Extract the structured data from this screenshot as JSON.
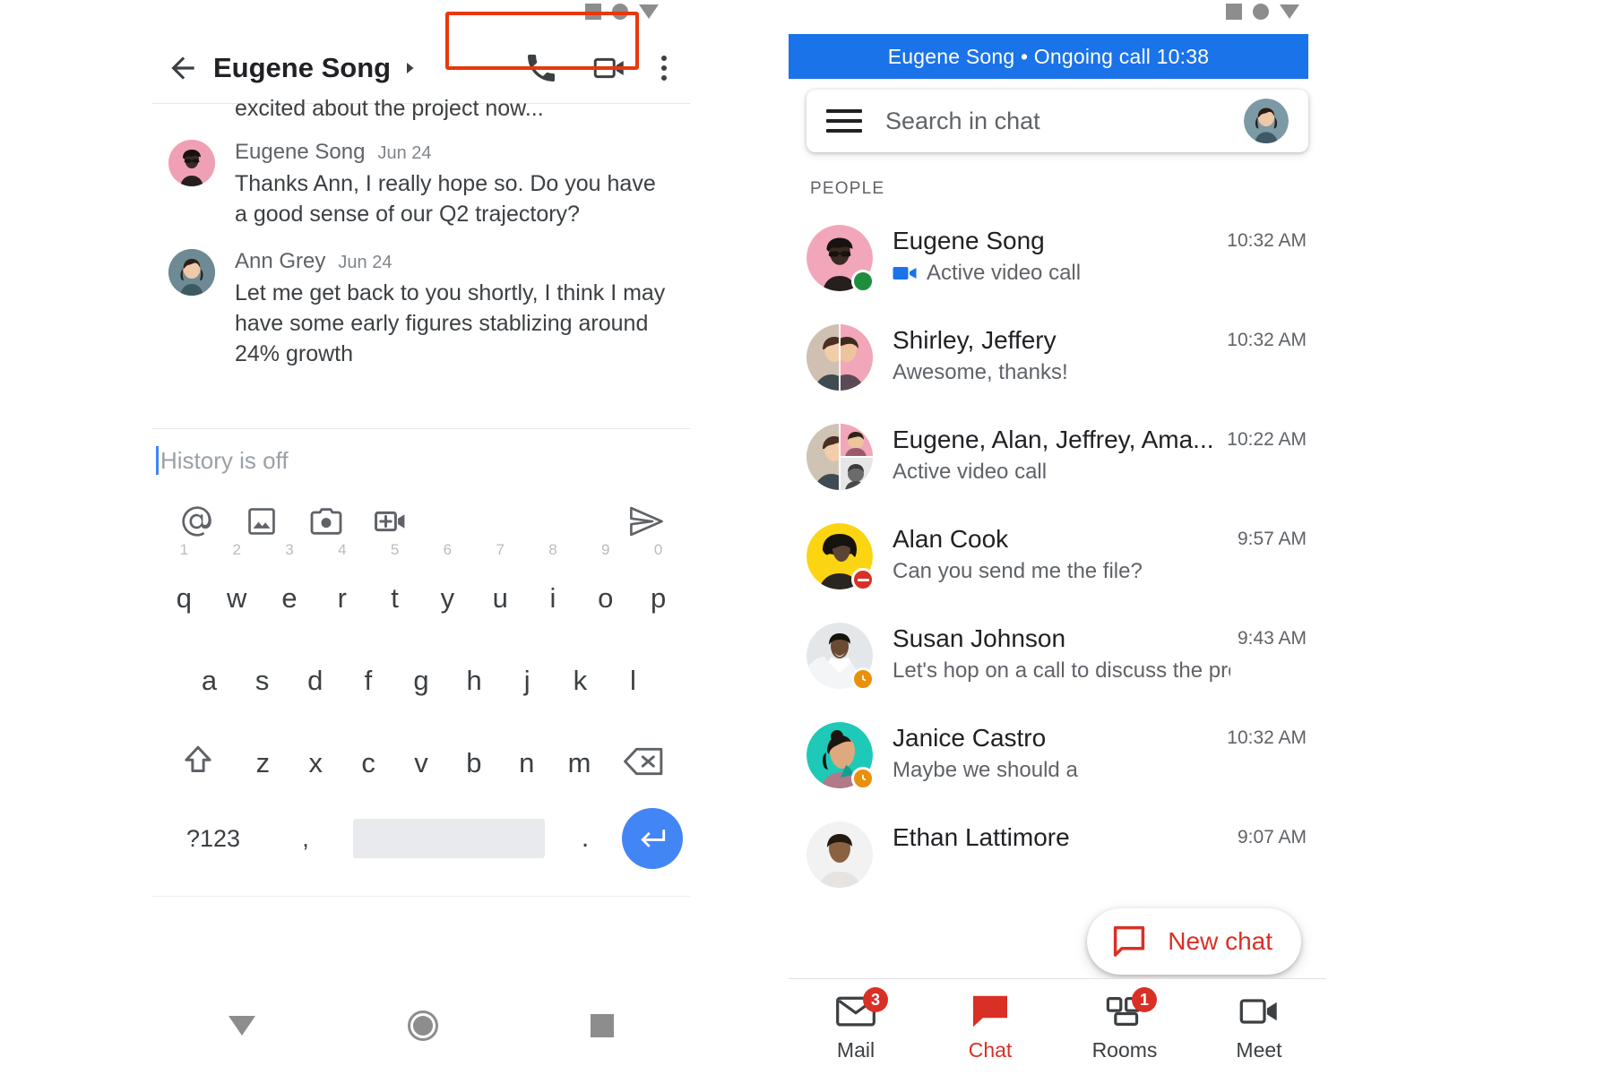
{
  "left": {
    "status_icons": [
      "square-icon",
      "circle-icon",
      "triangle-down-icon"
    ],
    "header": {
      "back_icon": "back-arrow-icon",
      "title": "Eugene Song",
      "caret_icon": "caret-right-icon",
      "call_icon": "phone-icon",
      "video_icon": "video-camera-icon",
      "overflow_icon": "kebab-menu-icon",
      "highlight_color": "#e8380d"
    },
    "partial_message": "excited about the project now...",
    "messages": [
      {
        "author": "Eugene Song",
        "date": "Jun 24",
        "text": "Thanks Ann, I really hope so. Do you have a good sense of our Q2 trajectory?",
        "avatar_bg": "#f0a0b4"
      },
      {
        "author": "Ann Grey",
        "date": "Jun 24",
        "text": "Let me get back to you shortly, I think I may have some early figures stablizing around 24% growth",
        "avatar_bg": "#5c7c8a"
      }
    ],
    "compose": {
      "placeholder": "History is off",
      "value": "",
      "icons": [
        "at-mention-icon",
        "image-icon",
        "camera-icon",
        "add-video-icon"
      ],
      "send_icon": "send-icon"
    },
    "keyboard": {
      "row1_numbers": [
        "1",
        "2",
        "3",
        "4",
        "5",
        "6",
        "7",
        "8",
        "9",
        "0"
      ],
      "row1": [
        "q",
        "w",
        "e",
        "r",
        "t",
        "y",
        "u",
        "i",
        "o",
        "p"
      ],
      "row2": [
        "a",
        "s",
        "d",
        "f",
        "g",
        "h",
        "j",
        "k",
        "l"
      ],
      "row3": [
        "z",
        "x",
        "c",
        "v",
        "b",
        "n",
        "m"
      ],
      "shift_icon": "shift-up-icon",
      "backspace_icon": "backspace-icon",
      "symbols_key": "?123",
      "comma_key": ",",
      "period_key": ".",
      "space_key": "",
      "enter_icon": "enter-return-icon"
    },
    "system_nav": [
      "back-triangle-icon",
      "home-circle-icon",
      "recents-square-icon"
    ]
  },
  "right": {
    "status_icons": [
      "square-icon",
      "circle-icon",
      "triangle-down-icon"
    ],
    "call_banner": {
      "text": "Eugene Song • Ongoing call 10:38",
      "color": "#1a73e8"
    },
    "search": {
      "menu_icon": "hamburger-menu-icon",
      "placeholder": "Search in chat",
      "value": "",
      "avatar_icon": "account-avatar"
    },
    "section_label": "PEOPLE",
    "people": [
      {
        "name": "Eugene Song",
        "preview": "Active video call",
        "time": "10:32 AM",
        "status": "online",
        "has_video_icon": true,
        "avatar_bg": "#f0a0b4"
      },
      {
        "name": "Shirley, Jeffery",
        "preview": "Awesome, thanks!",
        "time": "10:32 AM",
        "status": "none",
        "has_video_icon": false,
        "avatar_bg": "#f3b8c4"
      },
      {
        "name": "Eugene, Alan, Jeffrey, Ama...",
        "preview": "Active video call",
        "time": "10:22 AM",
        "status": "none",
        "has_video_icon": false,
        "avatar_bg": "#d9c3b0"
      },
      {
        "name": "Alan Cook",
        "preview": "Can you send me the file?",
        "time": "9:57 AM",
        "status": "dnd",
        "has_video_icon": false,
        "avatar_bg": "#fbd512"
      },
      {
        "name": "Susan Johnson",
        "preview": "Let's hop on a call to discuss the presen...",
        "time": "9:43 AM",
        "status": "away",
        "has_video_icon": false,
        "avatar_bg": "#cfd8dc"
      },
      {
        "name": "Janice Castro",
        "preview": "Maybe we should a",
        "time": "10:32 AM",
        "status": "away",
        "has_video_icon": false,
        "avatar_bg": "#1ec9b7"
      },
      {
        "name": "Ethan Lattimore",
        "preview": "",
        "time": "9:07 AM",
        "status": "none",
        "has_video_icon": false,
        "avatar_bg": "#d7bfa6"
      }
    ],
    "fab": {
      "icon": "chat-bubble-icon",
      "label": "New chat",
      "color": "#d93025"
    },
    "tabs": [
      {
        "label": "Mail",
        "icon": "mail-icon",
        "badge": "3",
        "active": false
      },
      {
        "label": "Chat",
        "icon": "chat-icon",
        "badge": "",
        "active": true
      },
      {
        "label": "Rooms",
        "icon": "rooms-icon",
        "badge": "1",
        "active": false
      },
      {
        "label": "Meet",
        "icon": "meet-icon",
        "badge": "",
        "active": false
      }
    ]
  }
}
